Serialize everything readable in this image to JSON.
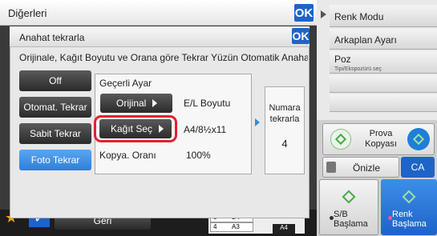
{
  "header": {
    "title": "Diğerleri",
    "ok_label": "OK"
  },
  "right_menu": {
    "items": [
      {
        "label": "Renk Modu"
      },
      {
        "label": "Arkaplan Ayarı"
      },
      {
        "label": "Poz",
        "sublabel": "Tipi/Ekspozürü seç"
      }
    ]
  },
  "dialog": {
    "title": "Anahat tekrarla",
    "ok_label": "OK",
    "description": "Orijinale, Kağıt Boyutu ve Orana göre Tekrar Yüzün Otomatik Anahat",
    "modes": [
      "Off",
      "Otomat. Tekrar",
      "Sabit Tekrar",
      "Foto Tekrar"
    ],
    "selected_mode": "Foto Tekrar",
    "current": {
      "title": "Geçerli Ayar",
      "rows": [
        {
          "button": "Orijinal",
          "value": "E/L Boyutu"
        },
        {
          "button": "Kağıt Seç",
          "value": "A4/8½x11"
        },
        {
          "label": "Kopya. Oranı",
          "value": "100%"
        }
      ]
    },
    "repeat": {
      "label_line1": "Numara",
      "label_line2": "tekrarla",
      "value": "4"
    }
  },
  "bottom": {
    "geri_label": "Geri",
    "tray": [
      {
        "num": "3",
        "size": "B4"
      },
      {
        "num": "4",
        "size": "A3"
      }
    ],
    "output_size": "A4"
  },
  "bottom_right": {
    "prova_line1": "Prova",
    "prova_line2": "Kopyası",
    "onizle": "Önizle",
    "ca": "CA",
    "sb_line1": "S/B",
    "sb_line2": "Başlama",
    "renk_line1": "Renk",
    "renk_line2": "Başlama"
  },
  "colors": {
    "accent_blue": "#1e63c8",
    "highlight_red": "#e4202c",
    "selected_mode": "#2f7fd8"
  }
}
